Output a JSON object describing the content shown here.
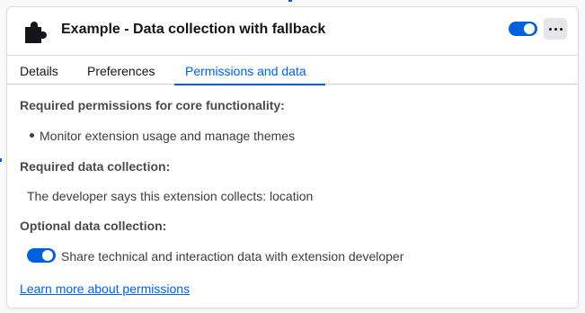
{
  "extension": {
    "icon": "puzzle-piece-icon",
    "title": "Example - Data collection with fallback",
    "enabled": true
  },
  "header": {
    "more_icon": "more-dots-icon"
  },
  "tabs": [
    {
      "label": "Details",
      "active": false
    },
    {
      "label": "Preferences",
      "active": false
    },
    {
      "label": "Permissions and data",
      "active": true
    }
  ],
  "permissions": {
    "required_heading": "Required permissions for core functionality:",
    "required_items": [
      "Monitor extension usage and manage themes"
    ],
    "data_heading": "Required data collection:",
    "data_text": "The developer says this extension collects: location",
    "optional_heading": "Optional data collection:",
    "optional_item_label": "Share technical and interaction data with extension developer",
    "optional_enabled": true,
    "learn_more": "Learn more about permissions"
  },
  "colors": {
    "accent": "#0061e0",
    "text": "#15141a",
    "muted": "#4a4a4f",
    "border": "#dcdce0"
  }
}
